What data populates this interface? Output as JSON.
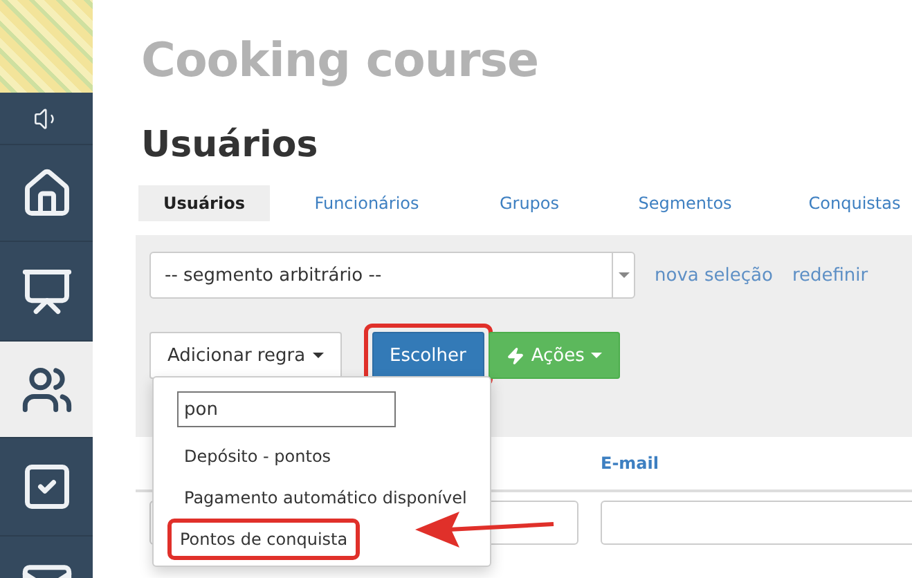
{
  "sidebar": {
    "items": [
      {
        "kind": "sound",
        "selected": false
      },
      {
        "kind": "home",
        "selected": false
      },
      {
        "kind": "chart",
        "selected": false
      },
      {
        "kind": "users",
        "selected": true
      },
      {
        "kind": "check",
        "selected": false
      },
      {
        "kind": "mail",
        "selected": false
      }
    ]
  },
  "app_title": "Cooking course",
  "page_heading": "Usuários",
  "tabs": [
    {
      "label": "Usuários",
      "selected": true
    },
    {
      "label": "Funcionários",
      "selected": false
    },
    {
      "label": "Grupos",
      "selected": false
    },
    {
      "label": "Segmentos",
      "selected": false
    },
    {
      "label": "Conquistas",
      "selected": false
    }
  ],
  "filter": {
    "segment_select": "-- segmento arbitrário --",
    "links": [
      "nova seleção",
      "redefinir"
    ]
  },
  "buttons": [
    {
      "kind": "dropdown",
      "label": "Adicionar regra",
      "highlighted": false
    },
    {
      "kind": "primary",
      "label": "Escolher",
      "highlighted": true
    },
    {
      "kind": "actions",
      "label": "Ações",
      "highlighted": false
    }
  ],
  "rule_menu": {
    "search": "pon",
    "items": [
      {
        "label": "Depósito - pontos",
        "highlighted": false
      },
      {
        "label": "Pagamento automático disponível",
        "highlighted": false
      },
      {
        "label": "Pontos de conquista",
        "highlighted": true
      }
    ]
  },
  "table": {
    "columns": [
      "E-mail"
    ]
  }
}
